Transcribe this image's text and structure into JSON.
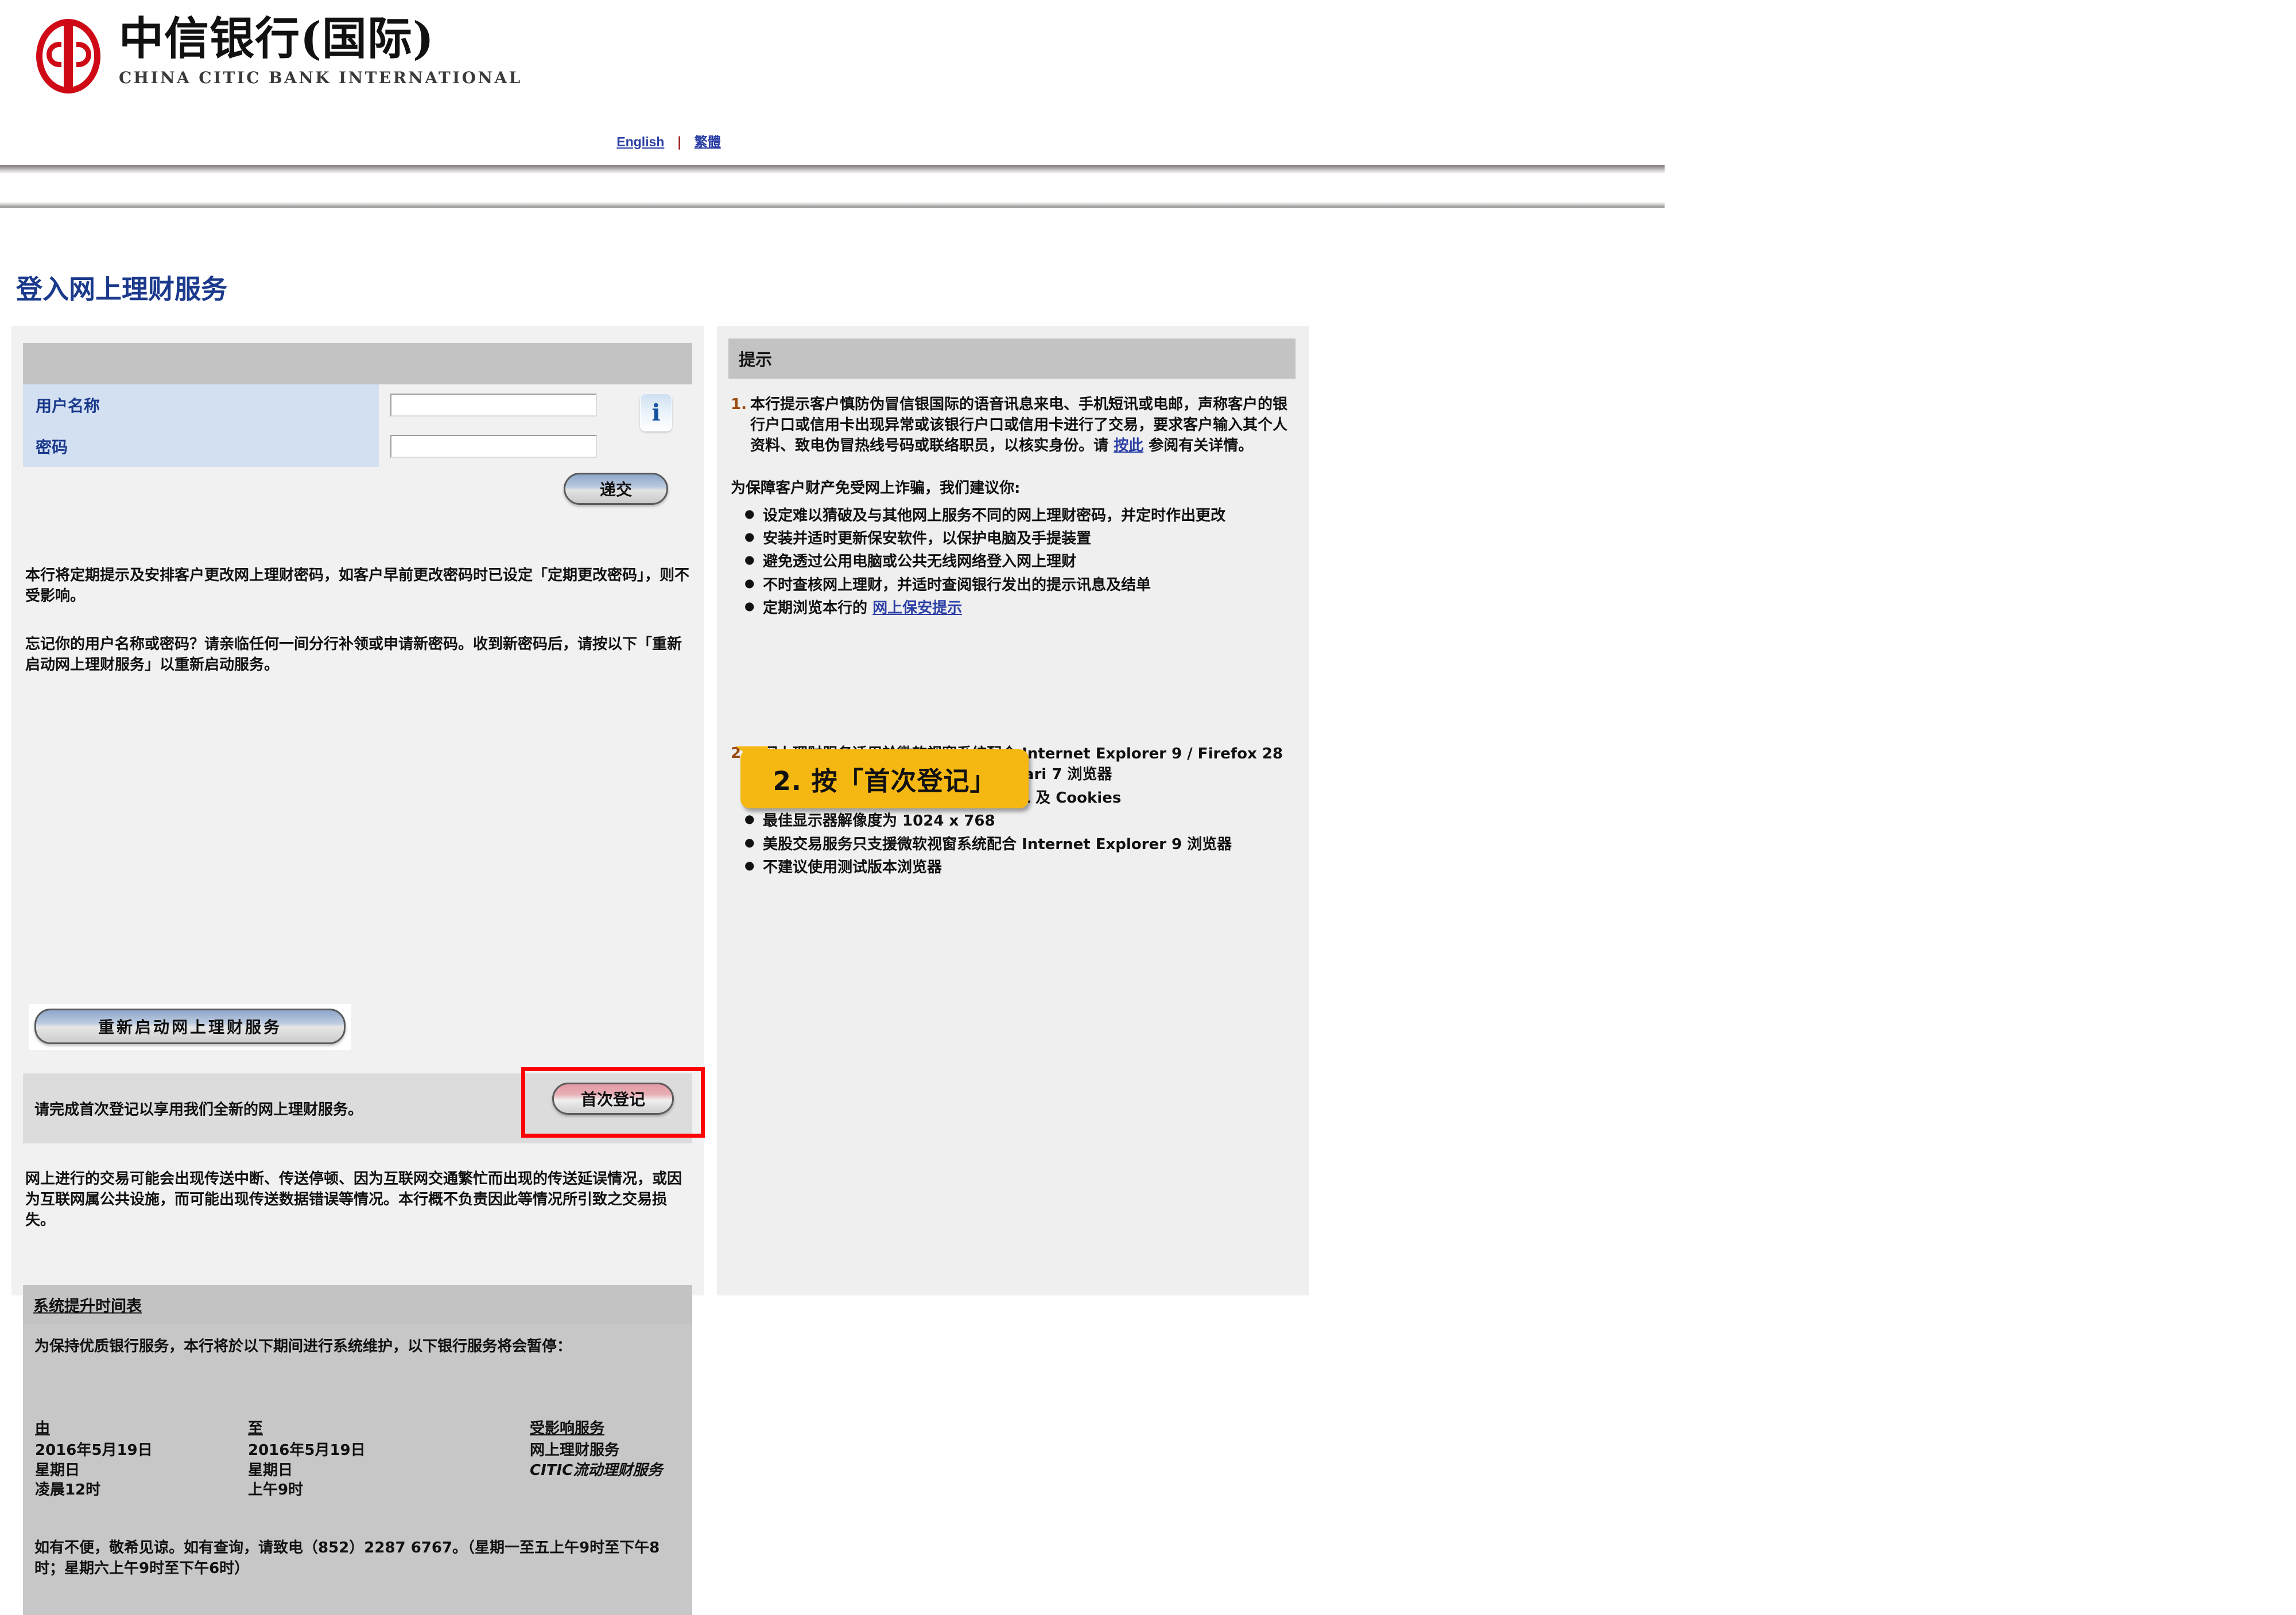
{
  "header": {
    "logo_cn": "中信银行(国际)",
    "logo_en": "CHINA CITIC BANK INTERNATIONAL",
    "lang_english": "English",
    "lang_separator": "|",
    "lang_traditional": "繁體"
  },
  "page": {
    "title": "登入网上理财服务"
  },
  "login": {
    "username_label": "用户名称",
    "password_label": "密码",
    "username_value": "",
    "password_value": "",
    "info_icon_label": "i",
    "submit_label": "递交"
  },
  "left": {
    "para1": "本行将定期提示及安排客户更改网上理财密码，如客户早前更改密码时已设定「定期更改密码」，则不受影响。",
    "para2": "忘记你的用户名称或密码？请亲临任何一间分行补领或申请新密码。收到新密码后，请按以下「重新启动网上理财服务」以重新启动服务。",
    "restart_button": "重新启动网上理财服务",
    "firstreg_text": "请完成首次登记以享用我们全新的网上理财服务。",
    "firstreg_button": "首次登记",
    "para3": "网上进行的交易可能会出现传送中断、传送停顿、因为互联网交通繁忙而出现的传送延误情况，或因为互联网属公共设施，而可能出现传送数据错误等情况。本行概不负责因此等情况所引致之交易损失。"
  },
  "schedule": {
    "title": "系统提升时间表",
    "intro": "为保持优质银行服务，本行将於以下期间进行系统维护，以下银行服务将会暂停：",
    "columns": [
      "由",
      "至",
      "受影响服务"
    ],
    "rows": [
      {
        "from": [
          "2016年5月19日",
          "星期日",
          "凌晨12时"
        ],
        "to": [
          "2016年5月19日",
          "星期日",
          "上午9时"
        ],
        "services": [
          "网上理财服务",
          "CITIC流动理财服务"
        ]
      }
    ],
    "note": "如有不便，敬希见谅。如有查询，请致电（852）2287 6767。（星期一至五上午9时至下午8时；星期六上午9时至下午6时）"
  },
  "tips": {
    "panel_title": "提示",
    "item1_number": "1.",
    "item1_text_a": "本行提示客户慎防伪冒信银国际的语音讯息来电、手机短讯或电邮，声称客户的银行户口或信用卡出现异常或该银行户口或信用卡进行了交易，要求客户输入其个人资料、致电伪冒热线号码或联络职员，以核实身份。请 ",
    "item1_link": "按此",
    "item1_text_b": " 参阅有关详情。",
    "advice_heading": "为保障客户财产免受网上诈骗，我们建议你:",
    "advice_bullets": [
      "设定难以猜破及与其他网上服务不同的网上理财密码，并定时作出更改",
      "安装并适时更新保安软件，以保护电脑及手提装置",
      "避免透过公用电脑或公共无线网络登入网上理财",
      "不时查核网上理财，并适时查阅银行发出的提示讯息及结单"
    ],
    "last_bullet_prefix": "定期浏览本行的 ",
    "last_bullet_link": "网上保安提示",
    "item2_number": "2.",
    "item2_bullets": [
      "网上理财服务适用於微软视窗系统配合 Internet Explorer 9 / Firefox 28 浏览器或该用 PC或MAC系统配合 Safari 7 浏览器",
      "浏览器需启用 Java, JavaScript, SSL 及 Cookies",
      "最佳显示器解像度为 1024 x 768",
      "美股交易服务只支援微软视窗系统配合 Internet Explorer 9 浏览器",
      "不建议使用测试版本浏览器"
    ]
  },
  "callout": {
    "text": "2. 按「首次登记」",
    "bg_color": "#f5b812"
  }
}
